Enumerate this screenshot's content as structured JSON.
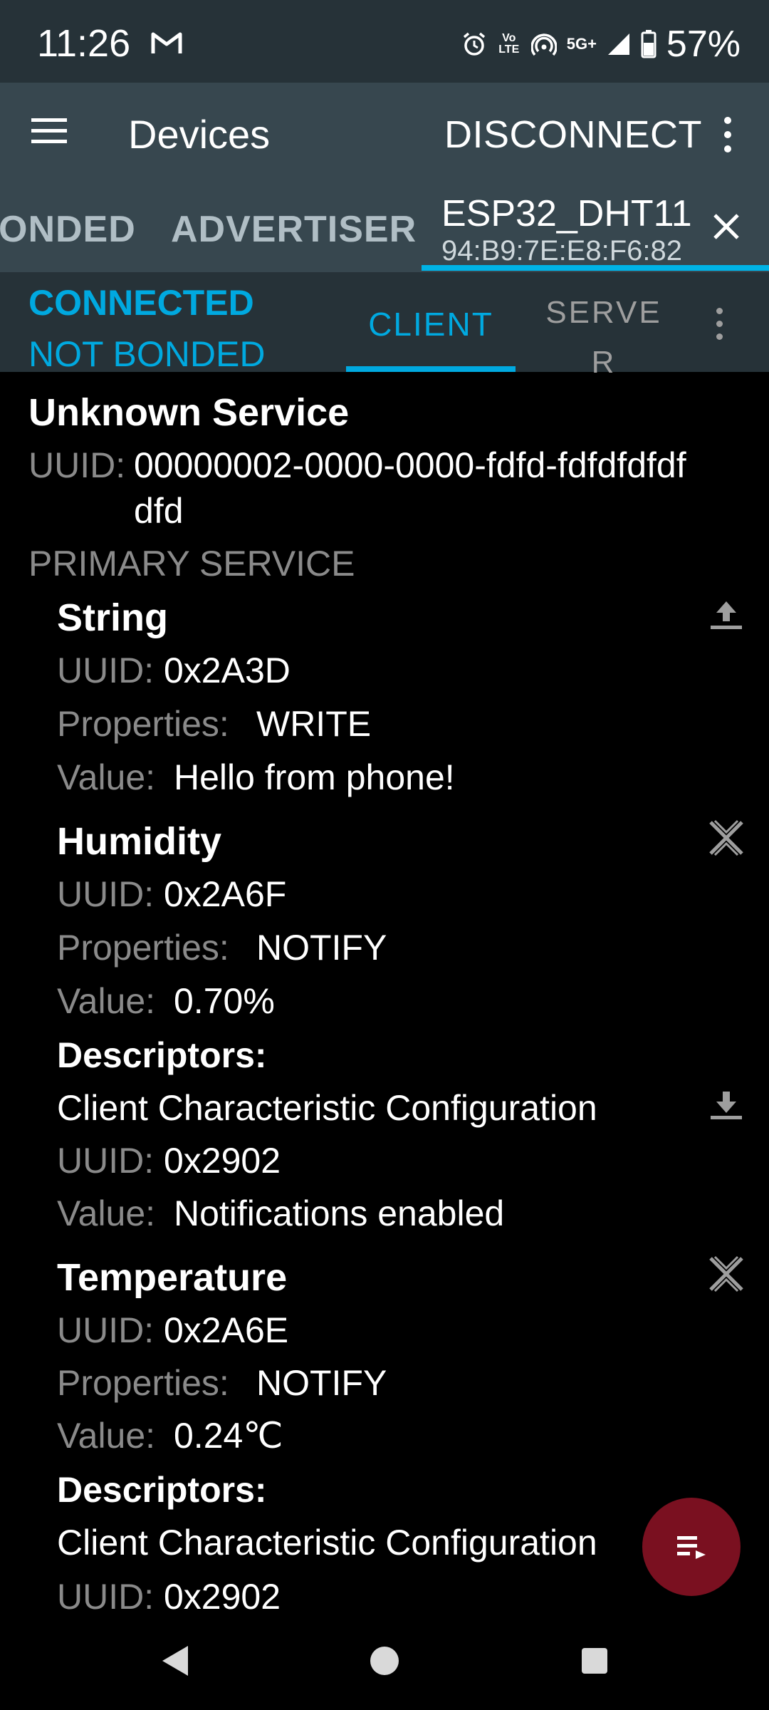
{
  "status_bar": {
    "time": "11:26",
    "network": "5G+",
    "volte": "Vo LTE",
    "battery": "57%"
  },
  "app_bar": {
    "title": "Devices",
    "disconnect_label": "DISCONNECT"
  },
  "device_tabs": {
    "bonded_label": "ONDED",
    "advertiser_label": "ADVERTISER",
    "active_device_name": "ESP32_DHT11",
    "active_device_mac": "94:B9:7E:E8:F6:82"
  },
  "connection": {
    "state": "CONNECTED",
    "bond": "NOT BONDED",
    "tab_client": "CLIENT",
    "tab_server": "SERVER"
  },
  "labels": {
    "uuid": "UUID:",
    "properties": "Properties:",
    "value": "Value:",
    "descriptors": "Descriptors:"
  },
  "service": {
    "name": "Unknown Service",
    "uuid_line1": "00000002-0000-0000-fdfd-fdfdfdfdf",
    "uuid_line2": "dfd",
    "type": "PRIMARY SERVICE"
  },
  "characteristics": [
    {
      "name": "String",
      "uuid": "0x2A3D",
      "properties": "WRITE",
      "value": "Hello from phone!",
      "action_icon": "upload-icon"
    },
    {
      "name": "Humidity",
      "uuid": "0x2A6F",
      "properties": "NOTIFY",
      "value": "0.70%",
      "action_icon": "notifications-off-icon",
      "descriptor": {
        "name": "Client Characteristic Configuration",
        "uuid": "0x2902",
        "value": "Notifications enabled",
        "action_icon": "download-icon"
      }
    },
    {
      "name": "Temperature",
      "uuid": "0x2A6E",
      "properties": "NOTIFY",
      "value": "0.24℃",
      "action_icon": "notifications-off-icon",
      "descriptor": {
        "name": "Client Characteristic Configuration",
        "uuid": "0x2902"
      }
    }
  ],
  "colors": {
    "accent": "#00a9e0",
    "appbar": "#37474f",
    "statusbar": "#263238",
    "fab": "#7a1020"
  }
}
